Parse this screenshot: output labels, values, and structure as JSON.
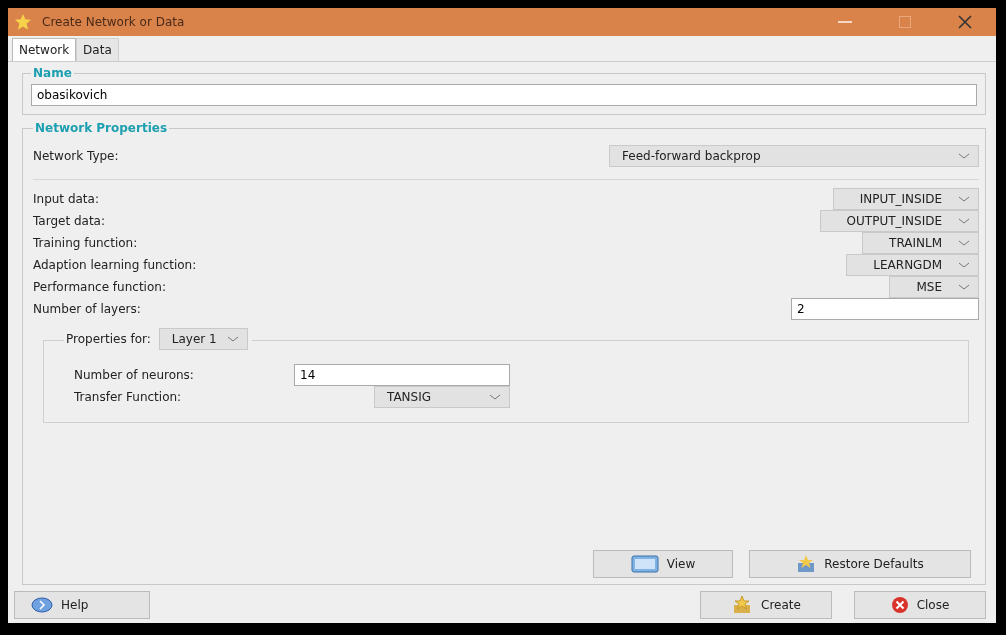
{
  "window": {
    "title": "Create Network or Data"
  },
  "tabs": [
    {
      "label": "Network",
      "selected": true
    },
    {
      "label": "Data",
      "selected": false
    }
  ],
  "name_group": {
    "title": "Name",
    "value": "obasikovich"
  },
  "properties": {
    "title": "Network Properties",
    "network_type": {
      "label": "Network Type:",
      "value": "Feed-forward backprop"
    },
    "params": [
      {
        "kind": "select",
        "label": "Input data:",
        "value": "INPUT_INSIDE"
      },
      {
        "kind": "select",
        "label": "Target data:",
        "value": "OUTPUT_INSIDE"
      },
      {
        "kind": "select",
        "label": "Training function:",
        "value": "TRAINLM"
      },
      {
        "kind": "select",
        "label": "Adaption learning function:",
        "value": "LEARNGDM"
      },
      {
        "kind": "select",
        "label": "Performance function:",
        "value": "MSE"
      },
      {
        "kind": "input",
        "label": "Number of layers:",
        "value": "2"
      }
    ],
    "layer": {
      "label": "Properties for:",
      "value": "Layer 1",
      "params": [
        {
          "kind": "input",
          "label": "Number of neurons:",
          "value": "14"
        },
        {
          "kind": "select",
          "label": "Transfer Function:",
          "value": "TANSIG"
        }
      ]
    },
    "buttons": [
      "View",
      "Restore Defaults"
    ]
  },
  "footer": {
    "help": "Help",
    "buttons": [
      "Create",
      "Close"
    ]
  }
}
